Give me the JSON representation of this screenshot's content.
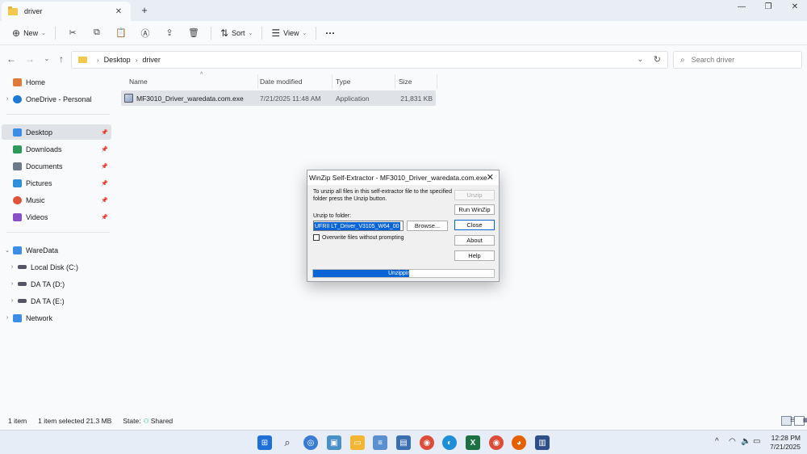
{
  "window": {
    "tab_title": "driver",
    "tab_close": "✕",
    "new_tab": "+",
    "minimize": "—",
    "maximize": "❐",
    "close": "✕"
  },
  "toolbar": {
    "new_label": "New",
    "sort_label": "Sort",
    "view_label": "View",
    "more": "···",
    "icons": [
      "cut-icon",
      "copy-icon",
      "paste-icon",
      "rename-icon",
      "share-icon",
      "delete-icon"
    ]
  },
  "address": {
    "crumbs": [
      "Desktop",
      "driver"
    ],
    "search_placeholder": "Search driver"
  },
  "sidebar": {
    "items": [
      {
        "label": "Home",
        "icon": "home-icon",
        "color": "#e07a3a"
      },
      {
        "label": "OneDrive - Personal",
        "icon": "cloud-icon",
        "color": "#1e78d4"
      },
      {
        "label": "Desktop",
        "icon": "desktop-icon",
        "color": "#3a8ee6"
      },
      {
        "label": "Downloads",
        "icon": "download-icon",
        "color": "#2c9a5a"
      },
      {
        "label": "Documents",
        "icon": "document-icon",
        "color": "#6c7a89"
      },
      {
        "label": "Pictures",
        "icon": "picture-icon",
        "color": "#2f8fd9"
      },
      {
        "label": "Music",
        "icon": "music-icon",
        "color": "#e0533a"
      },
      {
        "label": "Videos",
        "icon": "video-icon",
        "color": "#8a4fc9"
      },
      {
        "label": "WareData",
        "icon": "computer-icon",
        "color": "#3a8ee6"
      },
      {
        "label": "Local Disk (C:)",
        "icon": "drive-icon",
        "color": "#556"
      },
      {
        "label": "DA TA (D:)",
        "icon": "drive-icon",
        "color": "#556"
      },
      {
        "label": "DA TA (E:)",
        "icon": "drive-icon",
        "color": "#556"
      },
      {
        "label": "Network",
        "icon": "network-icon",
        "color": "#3a8ee6"
      }
    ]
  },
  "columns": [
    "Name",
    "Date modified",
    "Type",
    "Size"
  ],
  "files": [
    {
      "name": "MF3010_Driver_waredata.com.exe",
      "date": "7/21/2025 11:48 AM",
      "type": "Application",
      "size": "21,831 KB"
    }
  ],
  "status": {
    "count": "1 item",
    "selected": "1 item selected  21.3 MB",
    "state_label": "State:",
    "state_value": "Shared"
  },
  "dialog": {
    "title": "WinZip Self-Extractor - MF3010_Driver_waredata.com.exe",
    "message": "To unzip all files in this self-extractor file to the specified folder press the Unzip button.",
    "unzip_label": "Unzip to folder:",
    "folder_value": "UFRII LT_Driver_V3105_W64_00",
    "browse": "Browse...",
    "overwrite": "Overwrite files without prompting",
    "buttons": {
      "unzip": "Unzip",
      "run_winzip": "Run WinZip",
      "close": "Close",
      "about": "About",
      "help": "Help"
    },
    "progress_text": "Unzipping S",
    "progress_fraction": 0.53
  },
  "taskbar": {
    "time": "12:28 PM",
    "date": "7/21/2025",
    "apps": [
      {
        "name": "start-icon",
        "color": "#1f6fd6"
      },
      {
        "name": "search-icon",
        "color": "#333333"
      },
      {
        "name": "copilot-icon",
        "color": "#3a7bd5"
      },
      {
        "name": "widgets-icon",
        "color": "#4a90c8"
      },
      {
        "name": "file-explorer-icon",
        "color": "#f2b632"
      },
      {
        "name": "notepad-icon",
        "color": "#5a8fd0"
      },
      {
        "name": "notes-icon",
        "color": "#3c6fb0"
      },
      {
        "name": "chrome-icon",
        "color": "#dd4b39"
      },
      {
        "name": "edge-icon",
        "color": "#1e8fd6"
      },
      {
        "name": "excel-icon",
        "color": "#1d7044"
      },
      {
        "name": "chrome-icon",
        "color": "#dd4b39"
      },
      {
        "name": "firefox-icon",
        "color": "#e66000"
      },
      {
        "name": "winzip-icon",
        "color": "#2d4f8a"
      }
    ]
  }
}
